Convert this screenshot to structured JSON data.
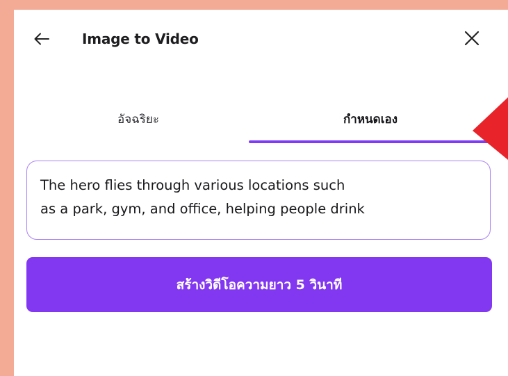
{
  "dialog": {
    "title": "Image to Video",
    "back_icon": "arrow-left-icon",
    "close_icon": "close-icon"
  },
  "tabs": [
    {
      "label": "อัจฉริยะ",
      "active": false
    },
    {
      "label": "กำหนดเอง",
      "active": true
    }
  ],
  "prompt": {
    "lines": [
      "The hero flies through various locations such",
      "as a park, gym, and office, helping people drink"
    ]
  },
  "generate_button": {
    "label": "สร้างวิดีโอความยาว 5 วินาที"
  },
  "colors": {
    "background": "#f4ab96",
    "accent": "#7f3cf6",
    "button": "#8237f1",
    "prompt_border": "#a880f5",
    "pointer_arrow": "#e8232a"
  }
}
